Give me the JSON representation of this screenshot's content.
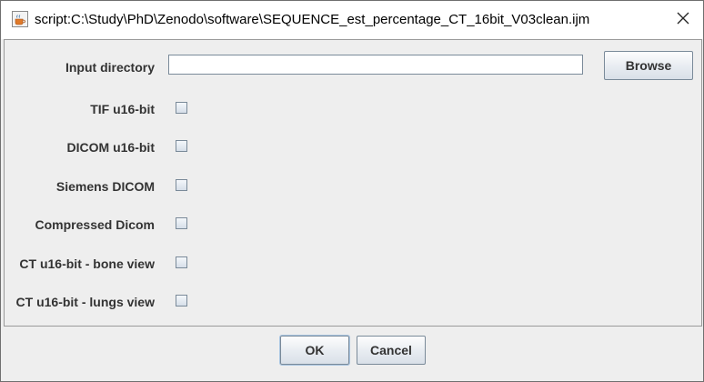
{
  "window": {
    "title": "script:C:\\Study\\PhD\\Zenodo\\software\\SEQUENCE_est_percentage_CT_16bit_V03clean.ijm",
    "app_icon": "java-cup-icon",
    "close_icon": "close-icon"
  },
  "form": {
    "input_directory": {
      "label": "Input directory",
      "value": "",
      "browse_label": "Browse"
    },
    "options": [
      {
        "label": "TIF u16-bit",
        "checked": false
      },
      {
        "label": "DICOM u16-bit",
        "checked": false
      },
      {
        "label": "Siemens DICOM",
        "checked": false
      },
      {
        "label": "Compressed Dicom",
        "checked": false
      },
      {
        "label": "CT u16-bit - bone view",
        "checked": false
      },
      {
        "label": "CT u16-bit - lungs view",
        "checked": false
      }
    ]
  },
  "buttons": {
    "ok": "OK",
    "cancel": "Cancel"
  }
}
